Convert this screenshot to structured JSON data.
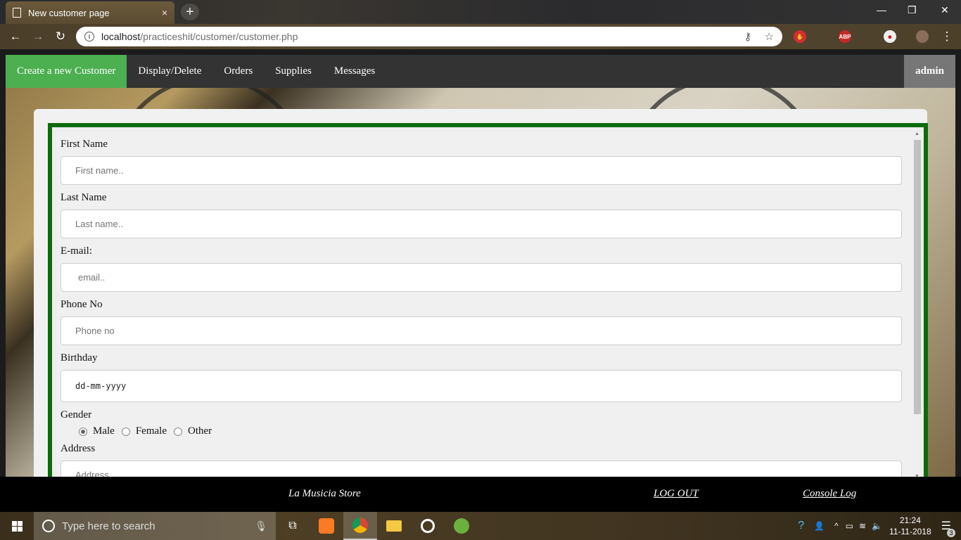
{
  "browser": {
    "tab_title": "New customer page",
    "tab_close": "×",
    "new_tab": "+",
    "url_host": "localhost",
    "url_path": "/practiceshit/customer/customer.php",
    "window_controls": [
      "—",
      "❐",
      "✕"
    ],
    "nav": {
      "back": "←",
      "forward": "→",
      "reload": "↻"
    }
  },
  "nav": {
    "items": [
      {
        "label": "Create a new Customer"
      },
      {
        "label": "Display/Delete"
      },
      {
        "label": "Orders"
      },
      {
        "label": "Supplies"
      },
      {
        "label": "Messages"
      }
    ],
    "user": "admin"
  },
  "form": {
    "first_name": {
      "label": "First Name",
      "placeholder": "First name.."
    },
    "last_name": {
      "label": "Last Name",
      "placeholder": "Last name.."
    },
    "email": {
      "label": "E-mail:",
      "placeholder": "email.."
    },
    "phone": {
      "label": "Phone No",
      "placeholder": "Phone no"
    },
    "birthday": {
      "label": "Birthday",
      "value": "dd-mm-yyyy"
    },
    "gender": {
      "label": "Gender",
      "options": [
        "Male",
        "Female",
        "Other"
      ],
      "selected": "Male"
    },
    "address": {
      "label": "Address",
      "placeholder": "Address"
    }
  },
  "footer": {
    "store": "La Musicia Store",
    "logout": "LOG OUT",
    "console": "Console Log"
  },
  "taskbar": {
    "search_placeholder": "Type here to search",
    "time": "21:24",
    "date": "11-11-2018",
    "notifications": "3"
  },
  "colors": {
    "nav_active": "#4caf50",
    "nav_bg": "#333333",
    "form_border": "#0b6b0b"
  }
}
